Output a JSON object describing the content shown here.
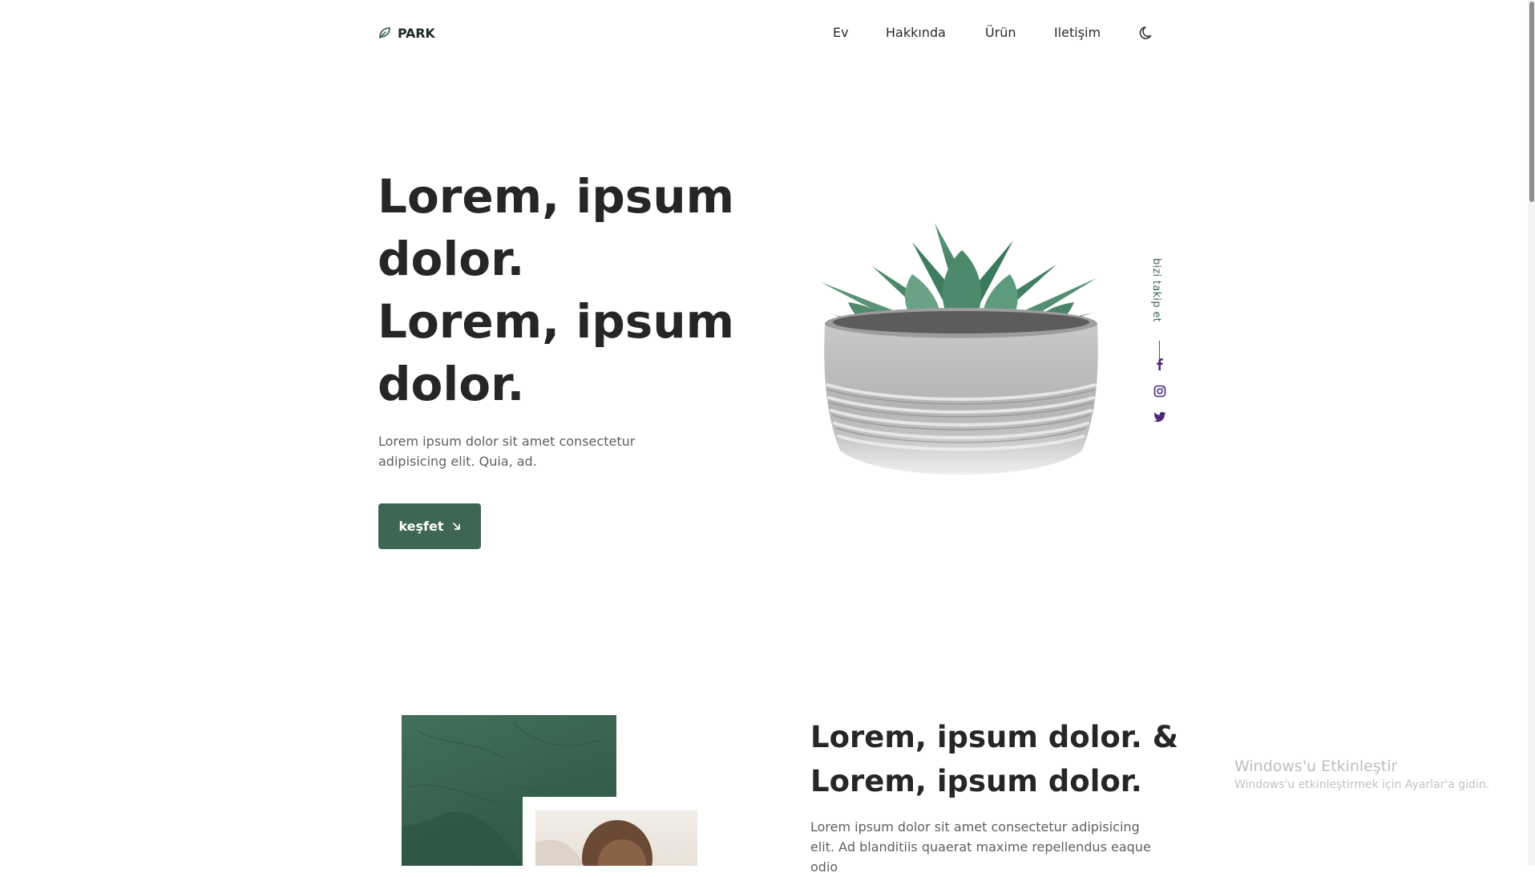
{
  "header": {
    "logo_text": "PARK",
    "logo_icon": "leaf-icon",
    "nav": [
      {
        "label": "Ev"
      },
      {
        "label": "Hakkında"
      },
      {
        "label": "Ürün"
      },
      {
        "label": "Iletişim"
      }
    ],
    "theme_icon": "moon-icon"
  },
  "hero": {
    "title_lines": [
      "Lorem, ipsum",
      "dolor.",
      "Lorem, ipsum",
      "dolor."
    ],
    "description": "Lorem ipsum dolor sit amet consectetur adipisicing elit. Quia, ad.",
    "button_label": "keşfet",
    "button_icon": "arrow-down-right-icon"
  },
  "social": {
    "label": "bizi takip et",
    "icons": [
      "facebook-icon",
      "instagram-icon",
      "twitter-icon"
    ]
  },
  "section2": {
    "title": "Lorem, ipsum dolor. & Lorem, ipsum dolor.",
    "description": "Lorem ipsum dolor sit amet consectetur adipisicing elit. Ad blanditiis quaerat maxime repellendus eaque odio"
  },
  "watermark": {
    "title": "Windows'u Etkinleştir",
    "subtitle": "Windows'u etkinleştirmek için Ayarlar'a gidin."
  },
  "colors": {
    "accent": "#3d6653",
    "text": "#262626",
    "muted": "#5f5f5f",
    "social_icon": "#4b2a7b"
  }
}
